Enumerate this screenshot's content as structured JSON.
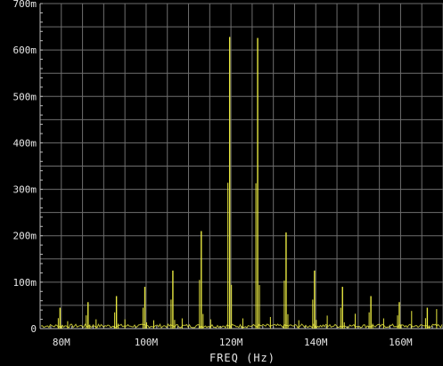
{
  "chart_data": {
    "type": "line",
    "title": "",
    "xlabel": "FREQ (Hz)",
    "ylabel": "",
    "xlim": [
      75,
      170
    ],
    "ylim": [
      0,
      700
    ],
    "x_ticks": [
      80,
      100,
      120,
      140,
      160
    ],
    "x_tick_labels": [
      "80M",
      "100M",
      "120M",
      "140M",
      "160M"
    ],
    "y_ticks": [
      0,
      100,
      200,
      300,
      400,
      500,
      600,
      700
    ],
    "y_tick_labels": [
      "0",
      "100m",
      "200m",
      "300m",
      "400m",
      "500m",
      "600m",
      "700m"
    ],
    "grid": true,
    "background_color": "#000000",
    "grid_color": "#6e6e6e",
    "series": [
      {
        "color": "#e8e840",
        "peaks": [
          {
            "x": 79.7,
            "y": 45
          },
          {
            "x": 86.3,
            "y": 57
          },
          {
            "x": 93.0,
            "y": 70
          },
          {
            "x": 99.7,
            "y": 90
          },
          {
            "x": 106.3,
            "y": 125
          },
          {
            "x": 113.0,
            "y": 210
          },
          {
            "x": 119.7,
            "y": 628
          },
          {
            "x": 126.3,
            "y": 626
          },
          {
            "x": 133.0,
            "y": 207
          },
          {
            "x": 139.7,
            "y": 125
          },
          {
            "x": 146.3,
            "y": 90
          },
          {
            "x": 153.0,
            "y": 70
          },
          {
            "x": 159.7,
            "y": 57
          },
          {
            "x": 166.3,
            "y": 45
          }
        ],
        "minor_peaks": [
          {
            "x": 81.5,
            "y": 16
          },
          {
            "x": 88.2,
            "y": 20
          },
          {
            "x": 95.0,
            "y": 20
          },
          {
            "x": 101.8,
            "y": 18
          },
          {
            "x": 108.5,
            "y": 22
          },
          {
            "x": 115.2,
            "y": 20
          },
          {
            "x": 122.8,
            "y": 22
          },
          {
            "x": 129.3,
            "y": 25
          },
          {
            "x": 136.0,
            "y": 18
          },
          {
            "x": 142.7,
            "y": 28
          },
          {
            "x": 149.3,
            "y": 32
          },
          {
            "x": 156.0,
            "y": 22
          },
          {
            "x": 162.6,
            "y": 38
          },
          {
            "x": 168.5,
            "y": 42
          }
        ]
      }
    ]
  }
}
